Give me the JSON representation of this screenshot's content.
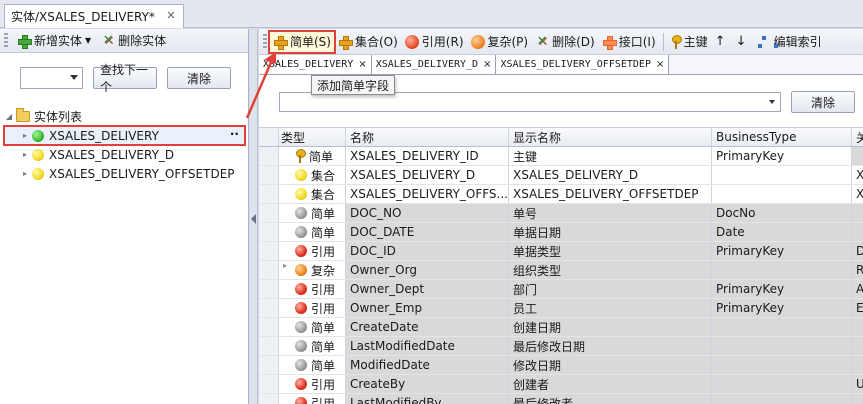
{
  "doc_tab": {
    "title": "实体/XSALES_DELIVERY*"
  },
  "left": {
    "toolbar": {
      "add_label": "新增实体",
      "delete_label": "删除实体"
    },
    "search": {
      "find_next": "查找下一个",
      "clear": "清除",
      "combo_value": ""
    },
    "tree": {
      "root_label": "实体列表",
      "items": [
        {
          "label": "XSALES_DELIVERY",
          "color": "green",
          "selected": true
        },
        {
          "label": "XSALES_DELIVERY_D",
          "color": "yellow"
        },
        {
          "label": "XSALES_DELIVERY_OFFSETDEP",
          "color": "yellow"
        }
      ],
      "selected_marker": "··"
    }
  },
  "right": {
    "toolbar": {
      "simple": "简单(S)",
      "set": "集合(O)",
      "ref": "引用(R)",
      "complex": "复杂(P)",
      "delete": "删除(D)",
      "interface": "接口(I)",
      "pk": "主键",
      "up": "↑",
      "down": "↓",
      "edit_index": "编辑索引"
    },
    "tabs": [
      "XSALES_DELIVERY",
      "XSALES_DELIVERY_D",
      "XSALES_DELIVERY_OFFSETDEP"
    ],
    "tooltip": "添加简单字段",
    "filter": {
      "value": "",
      "clear": "清除"
    },
    "grid": {
      "headers": {
        "type": "类型",
        "name": "名称",
        "display": "显示名称",
        "business": "BusinessType",
        "more": "关"
      },
      "rows": [
        {
          "icon": "key",
          "type": "简单",
          "name": "XSALES_DELIVERY_ID",
          "display": "主键",
          "business": "PrimaryKey",
          "more": "",
          "shade": "white"
        },
        {
          "icon": "yellow",
          "type": "集合",
          "name": "XSALES_DELIVERY_D",
          "display": "XSALES_DELIVERY_D",
          "business": "",
          "more": "X",
          "shade": "white"
        },
        {
          "icon": "yellow",
          "type": "集合",
          "name": "XSALES_DELIVERY_OFFS...",
          "display": "XSALES_DELIVERY_OFFSETDEP",
          "business": "",
          "more": "X",
          "shade": "white"
        },
        {
          "icon": "gray",
          "type": "简单",
          "name": "DOC_NO",
          "display": "单号",
          "business": "DocNo",
          "more": "",
          "shade": "gray"
        },
        {
          "icon": "gray",
          "type": "简单",
          "name": "DOC_DATE",
          "display": "单据日期",
          "business": "Date",
          "more": "",
          "shade": "gray"
        },
        {
          "icon": "red",
          "type": "引用",
          "name": "DOC_ID",
          "display": "单据类型",
          "business": "PrimaryKey",
          "more": "D",
          "shade": "gray"
        },
        {
          "icon": "orange",
          "type": "复杂",
          "name": "Owner_Org",
          "display": "组织类型",
          "business": "",
          "more": "R",
          "shade": "gray",
          "expandable": true
        },
        {
          "icon": "red",
          "type": "引用",
          "name": "Owner_Dept",
          "display": "部门",
          "business": "PrimaryKey",
          "more": "A",
          "shade": "gray"
        },
        {
          "icon": "red",
          "type": "引用",
          "name": "Owner_Emp",
          "display": "员工",
          "business": "PrimaryKey",
          "more": "E",
          "shade": "gray"
        },
        {
          "icon": "gray",
          "type": "简单",
          "name": "CreateDate",
          "display": "创建日期",
          "business": "",
          "more": "",
          "shade": "gray"
        },
        {
          "icon": "gray",
          "type": "简单",
          "name": "LastModifiedDate",
          "display": "最后修改日期",
          "business": "",
          "more": "",
          "shade": "gray"
        },
        {
          "icon": "gray",
          "type": "简单",
          "name": "ModifiedDate",
          "display": "修改日期",
          "business": "",
          "more": "",
          "shade": "gray"
        },
        {
          "icon": "red",
          "type": "引用",
          "name": "CreateBy",
          "display": "创建者",
          "business": "",
          "more": "U",
          "shade": "gray"
        },
        {
          "icon": "red",
          "type": "引用",
          "name": "LastModifiedBy",
          "display": "最后修改者",
          "business": "",
          "more": "",
          "shade": "gray"
        }
      ]
    }
  },
  "colors": {
    "highlight": "#e0413a",
    "selection": "#eaf1fb"
  }
}
